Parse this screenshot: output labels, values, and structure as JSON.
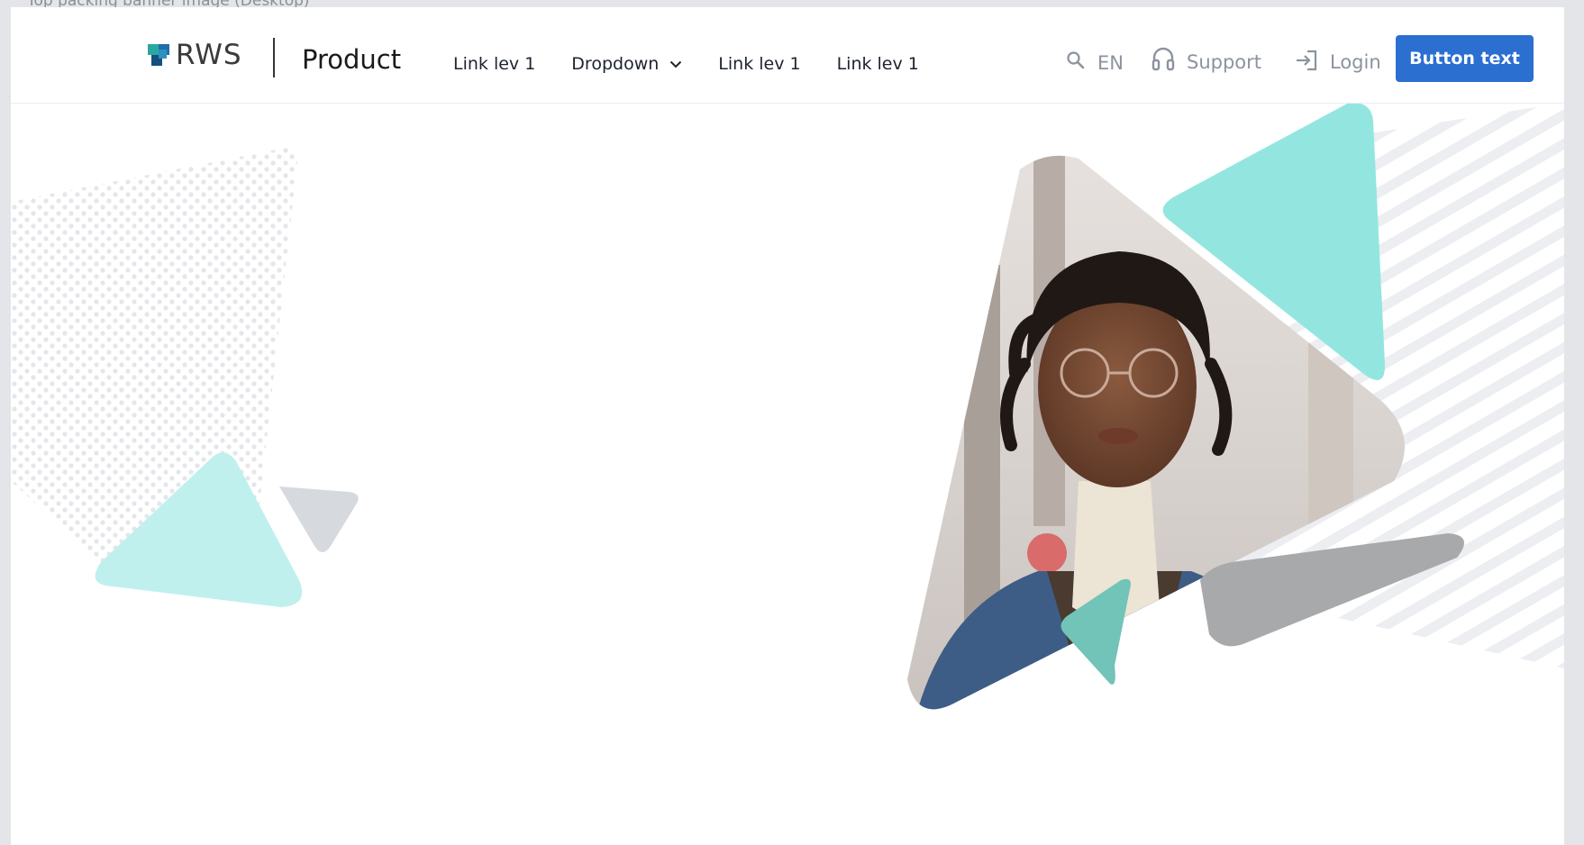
{
  "page": {
    "caption": "Top packing banner image (Desktop)"
  },
  "header": {
    "brand": "RWS",
    "product": "Product",
    "nav": [
      {
        "label": "Link lev 1"
      },
      {
        "label": "Dropdown",
        "has_dropdown": true
      },
      {
        "label": "Link lev 1"
      },
      {
        "label": "Link lev 1"
      }
    ],
    "utilities": {
      "search_icon": "search-icon",
      "language": "EN",
      "support_label": "Support",
      "support_icon": "headset-icon",
      "login_label": "Login",
      "login_icon": "login-icon"
    },
    "cta_label": "Button text"
  },
  "hero": {
    "image_description_icon": "portrait-photo"
  },
  "colors": {
    "accent": "#2b6fd1",
    "teal_light": "#c0f0ee",
    "teal": "#93e6df",
    "teal_dark": "#72c3b8",
    "grey_shape": "#d6d9de",
    "text_dark": "#1d2330",
    "text_muted": "#8c939e"
  }
}
